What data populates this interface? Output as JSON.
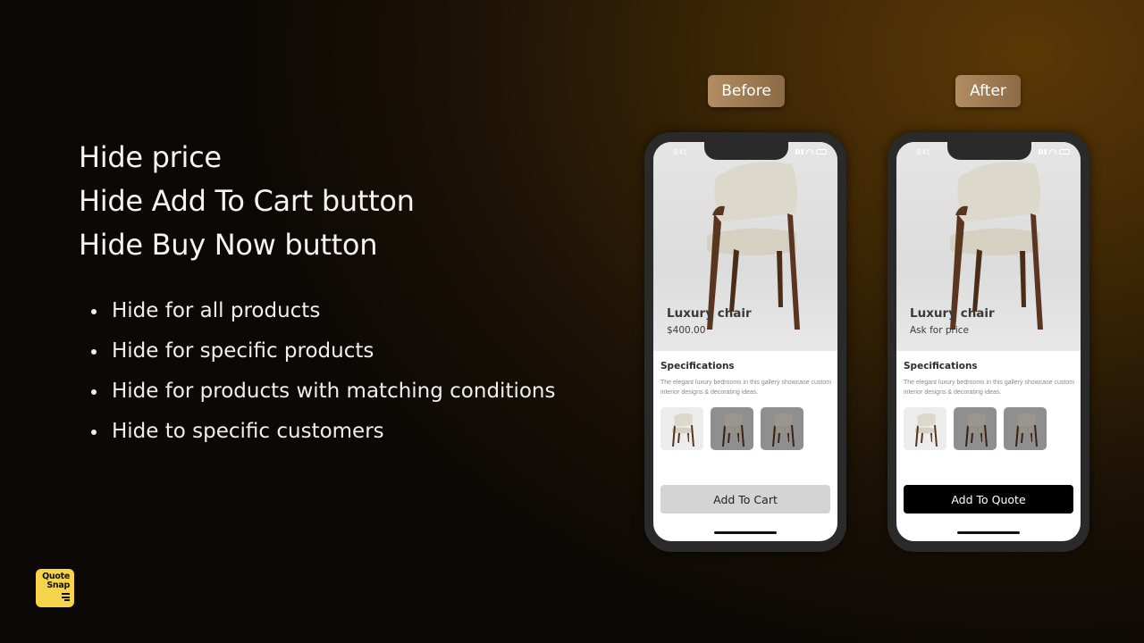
{
  "headings": [
    "Hide price",
    "Hide Add To Cart button",
    "Hide Buy Now button"
  ],
  "bullets": [
    "Hide for all products",
    "Hide for specific products",
    "Hide for products with matching conditions",
    "Hide to specific customers"
  ],
  "phones": [
    {
      "tag": "Before",
      "status_time": "9:41",
      "product_name": "Luxury chair",
      "price_text": "$400.00",
      "spec_title": "Specifications",
      "spec_desc": "The elegant luxury bedrooms in this gallery showcase custom interior designs & decorating ideas.",
      "cta_label": "Add To Cart"
    },
    {
      "tag": "After",
      "status_time": "9:41",
      "product_name": "Luxury chair",
      "price_text": "Ask for price",
      "spec_title": "Specifications",
      "spec_desc": "The elegant luxury bedrooms in this gallery showcase custom interior designs & decorating ideas.",
      "cta_label": "Add To Quote"
    }
  ],
  "logo": {
    "line1": "Quote",
    "line2": "Snap",
    "brand_color": "#f5d34a"
  },
  "colors": {
    "tag_gradient_start": "#b38d61",
    "tag_gradient_end": "#8b6a45",
    "quote_button": "#000000",
    "cart_button": "#d4d4d4"
  }
}
